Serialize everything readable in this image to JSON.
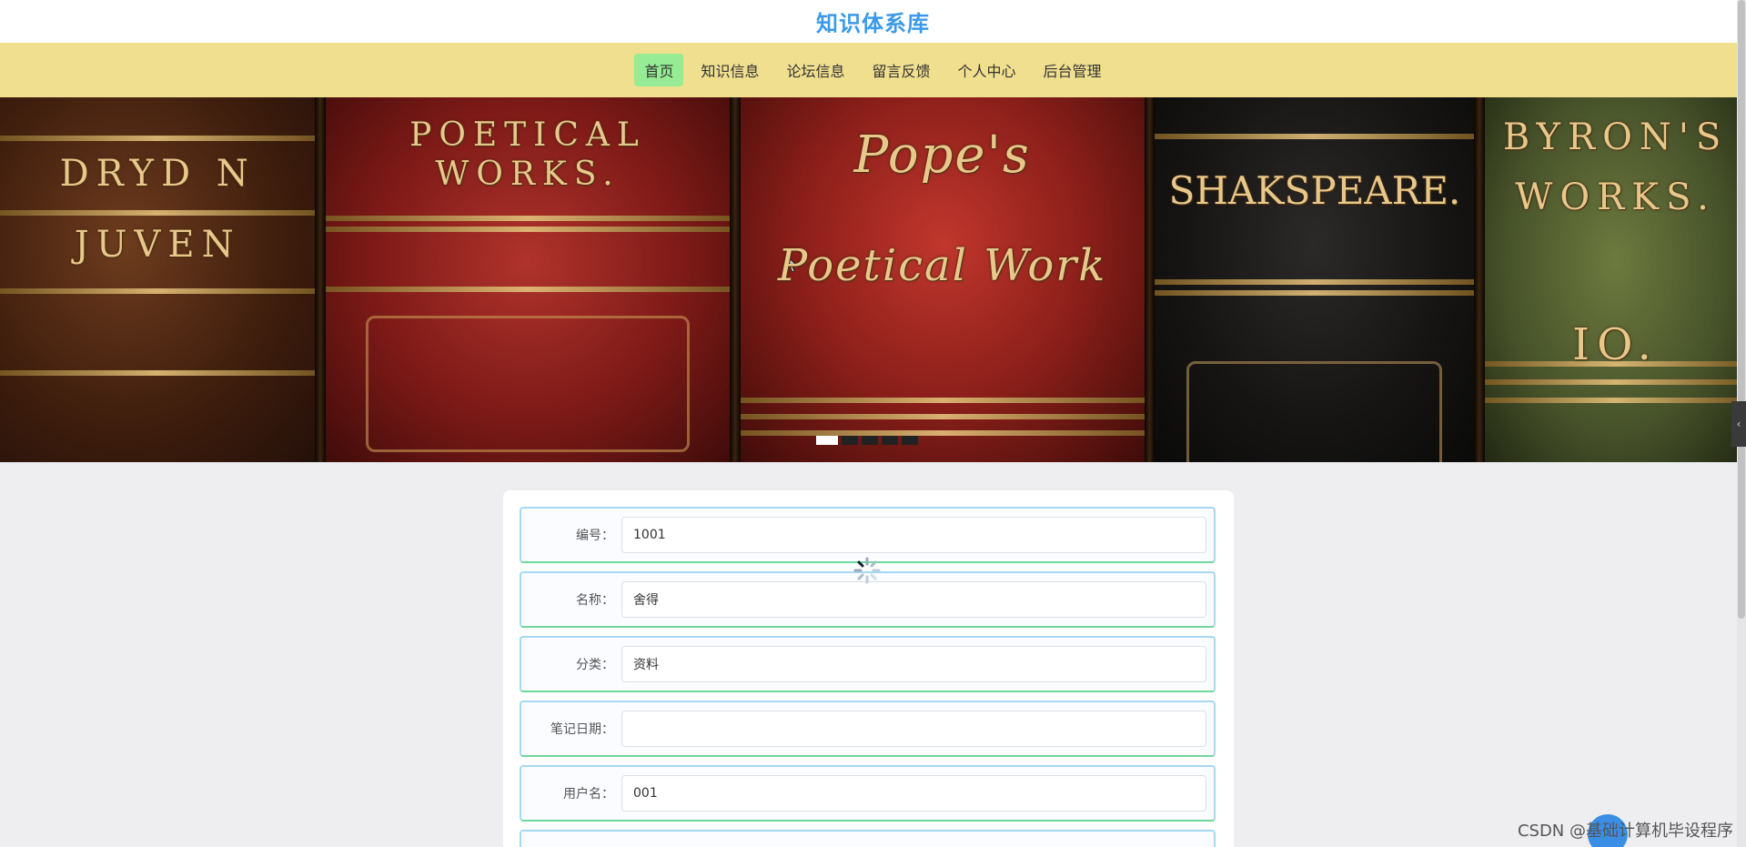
{
  "site": {
    "title": "知识体系库"
  },
  "nav": {
    "items": [
      {
        "label": "首页",
        "active": true
      },
      {
        "label": "知识信息",
        "active": false
      },
      {
        "label": "论坛信息",
        "active": false
      },
      {
        "label": "留言反馈",
        "active": false
      },
      {
        "label": "个人中心",
        "active": false
      },
      {
        "label": "后台管理",
        "active": false
      }
    ]
  },
  "banner": {
    "spines": [
      {
        "text_lines": [
          "DRYD N",
          "JUVEN"
        ]
      },
      {
        "text_lines": [
          "POETICAL",
          "WORKS."
        ]
      },
      {
        "text_lines": [
          "Pope's",
          "Poetical Work"
        ]
      },
      {
        "text_lines": [
          "SHAKSPEARE."
        ]
      },
      {
        "text_lines": [
          "BYRON'S",
          "WORKS.",
          "IO."
        ]
      }
    ],
    "slides_total": 5,
    "slide_active_index": 0
  },
  "form": {
    "fields": [
      {
        "label": "编号：",
        "value": "1001"
      },
      {
        "label": "名称：",
        "value": "舍得"
      },
      {
        "label": "分类：",
        "value": "资料"
      },
      {
        "label": "笔记日期：",
        "value": ""
      },
      {
        "label": "用户名：",
        "value": "001"
      }
    ]
  },
  "watermark": "CSDN @基础计算机毕设程序",
  "colors": {
    "title": "#3a9ae8",
    "nav_bg": "#f0df8e",
    "nav_active_bg": "#96ec94",
    "page_bg": "#eeeef0",
    "row_border": "#a6d8f3",
    "row_border_bottom": "#6fd79a"
  },
  "icons": {
    "side_toggle": "chevron-left-icon",
    "loading": "loading-spinner-icon",
    "chat": "chat-bubble-icon"
  }
}
